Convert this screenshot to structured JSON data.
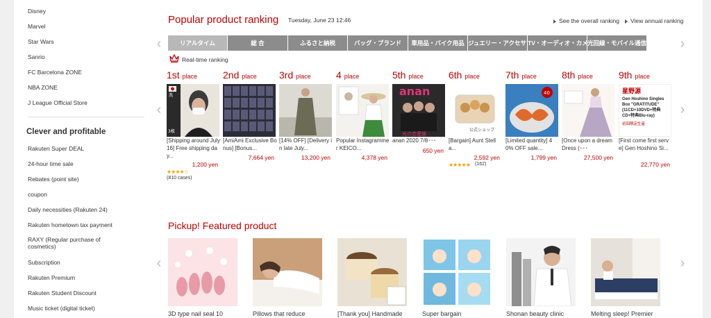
{
  "sidebar": {
    "items_top": [
      "Disney",
      "Marvel",
      "Star Wars",
      "Sanrio",
      "FC Barcelona ZONE",
      "NBA ZONE",
      "J League Official Store"
    ],
    "heading": "Clever and profitable",
    "items": [
      "Rakuten Super DEAL",
      "24-hour time sale",
      "Rebates (point site)",
      "coupon",
      "Daily necessities (Rakuten 24)",
      "Rakuten hometown tax payment",
      "RAXY (Regular purchase of cosmetics)",
      "Subscription",
      "Rakuten Premium",
      "Rakuten Student Discount",
      "Music ticket (digital ticket)"
    ]
  },
  "ranking": {
    "title": "Popular product ranking",
    "date": "Tuesday, June 23 12:46",
    "link_overall": "See the overall ranking",
    "link_annual": "View annual ranking",
    "tabs": [
      "リアルタイム",
      "総 合",
      "ふるさと納税",
      "バッグ・ブランド",
      "車用品・バイク用品",
      "ジュエリー・アクセサリー",
      "TV・オーディオ・カメラ",
      "光回線・モバイル通信"
    ],
    "active_tab": 0,
    "realtime_label": "Real-time ranking",
    "items": [
      {
        "rank": "1st",
        "suffix": "place",
        "title": "[Shipping around July 16] Free shipping day...",
        "price": "1,200 yen",
        "stars": "★★★★☆",
        "reviews": "(810 cases)",
        "thumb": "mask"
      },
      {
        "rank": "2nd",
        "suffix": "place",
        "title": "[AmiAmi Exclusive Bonus] [Bonus...",
        "price": "7,664 yen",
        "thumb": "cards"
      },
      {
        "rank": "3rd",
        "suffix": "place",
        "title": "[14% OFF] [Delivery in late July...",
        "price": "13,200 yen",
        "thumb": "dress"
      },
      {
        "rank": "4",
        "suffix": "place",
        "title": "Popular Instagrammer KEICO...",
        "price": "4,378 yen",
        "thumb": "hat"
      },
      {
        "rank": "5th",
        "suffix": "place",
        "title": "anan 2020 7/8･･･",
        "price": "650 yen",
        "thumb": "magazine"
      },
      {
        "rank": "6th",
        "suffix": "place",
        "title": "[Bargain] Aunt Stella...",
        "price": "2,592 yen",
        "stars": "★★★★★",
        "reviews": "(162)",
        "thumb": "cookies"
      },
      {
        "rank": "7th",
        "suffix": "place",
        "title": "[Limited quantity] 40% OFF sale...",
        "price": "1,799 yen",
        "thumb": "shrimp"
      },
      {
        "rank": "8th",
        "suffix": "place",
        "title": "[Once upon a dream Dress (･･･",
        "price": "27,500 yen",
        "thumb": "gown"
      },
      {
        "rank": "9th",
        "suffix": "place",
        "title": "[First come first serve] Gen Hoshino Si...",
        "price": "22,770 yen",
        "thumb": "cd",
        "cd_title": "星野源",
        "cd_sub": "Gen Hoshino Singles Box \"GRATITUDE\" (11CD+10DVD+特典CD+特典Blu-ray)",
        "cd_note": "初回限定生産"
      }
    ]
  },
  "pickup": {
    "title": "Pickup! Featured product",
    "items": [
      {
        "title": "3D type nail seal 10",
        "thumb": "nails"
      },
      {
        "title": "Pillows that reduce",
        "thumb": "pillow"
      },
      {
        "title": "[Thank you] Handmade",
        "thumb": "pudding"
      },
      {
        "title": "Super bargain",
        "thumb": "diapers"
      },
      {
        "title": "Shonan beauty clinic",
        "thumb": "doctor"
      },
      {
        "title": "Melting sleep! Premier",
        "thumb": "mattress"
      }
    ]
  },
  "rank_thumb_texts": {
    "magazine_logo": "anan",
    "magazine_cover": "光の恋愛論",
    "mask_banner": "洗える接触冷感UVカットマスク",
    "cookies_shop": "公式ショップ",
    "shrimp_badge": "40"
  },
  "colors": {
    "accent": "#bf0000",
    "tab": "#8c8c8c",
    "tab_active": "#b8b8b8",
    "sidebar_bg": "#f0f0f0"
  }
}
